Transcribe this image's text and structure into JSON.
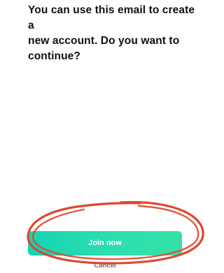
{
  "prompt": {
    "line1": "You can use this email to create a",
    "line2": "new account. Do you want to",
    "line3": "continue?"
  },
  "actions": {
    "join_label": "Join now",
    "cancel_label": "Cancel"
  },
  "colors": {
    "button_gradient_start": "#15d3b4",
    "button_gradient_end": "#34e0a6",
    "annotation_circle": "#e0462e"
  }
}
